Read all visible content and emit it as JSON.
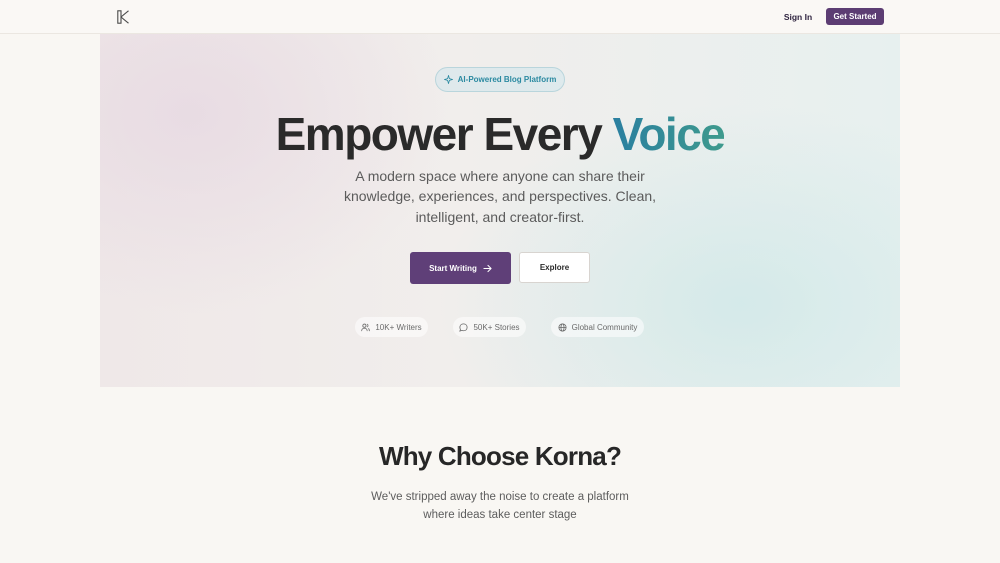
{
  "nav": {
    "sign_in": "Sign In",
    "get_started": "Get Started"
  },
  "hero": {
    "badge": "AI-Powered Blog Platform",
    "headline_main": "Empower Every ",
    "headline_accent": "Voice",
    "subtitle": "A modern space where anyone can share their knowledge, experiences, and perspectives. Clean, intelligent, and creator-first.",
    "primary_cta": "Start Writing",
    "secondary_cta": "Explore",
    "stats": [
      {
        "label": "10K+ Writers",
        "icon": "users-icon"
      },
      {
        "label": "50K+ Stories",
        "icon": "message-circle-icon"
      },
      {
        "label": "Global Community",
        "icon": "globe-icon"
      }
    ]
  },
  "why": {
    "title": "Why Choose Korna?",
    "text": "We've stripped away the noise to create a platform where ideas take center stage"
  },
  "colors": {
    "brand_purple": "#5f3f78",
    "accent_teal": "#2b8aa1",
    "accent_green": "#3e9a8d"
  }
}
